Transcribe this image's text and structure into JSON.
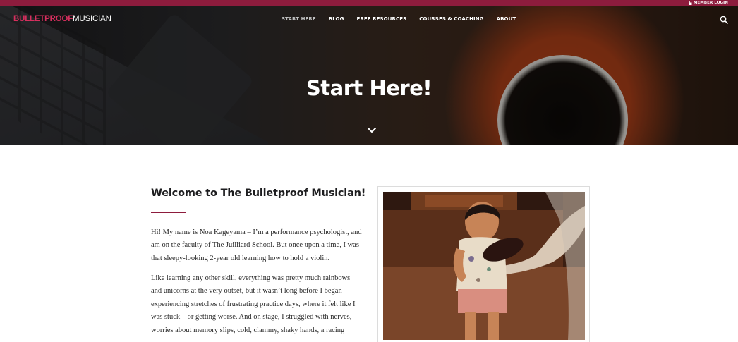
{
  "topbar": {
    "member_login": "MEMBER LOGIN",
    "accent_color": "#8d1c3d"
  },
  "header": {
    "logo": {
      "part1": "BULLETPROOF",
      "part2": "MUSICIAN"
    },
    "nav": [
      {
        "label": "START HERE",
        "active": true
      },
      {
        "label": "BLOG",
        "active": false
      },
      {
        "label": "FREE RESOURCES",
        "active": false
      },
      {
        "label": "COURSES & COACHING",
        "active": false
      },
      {
        "label": "ABOUT",
        "active": false
      }
    ],
    "search_icon": "search-icon"
  },
  "hero": {
    "title": "Start Here!",
    "chevron_icon": "chevron-down-icon"
  },
  "main": {
    "heading": "Welcome to The Bulletproof Musician!",
    "paragraphs": [
      "Hi! My name is Noa Kageyama – I’m a performance psychologist, and am on the faculty of The Juilliard School. But once upon a time, I was that sleepy-looking 2-year old learning how to hold a violin.",
      "Like learning any other skill, everything was pretty much rainbows and unicorns at the very outset, but it wasn’t long before I began experiencing stretches of frustrating practice days, where it felt like I was stuck – or getting worse. And on stage, I struggled with nerves, worries about memory slips, cold, clammy, shaky hands, a racing"
    ]
  }
}
